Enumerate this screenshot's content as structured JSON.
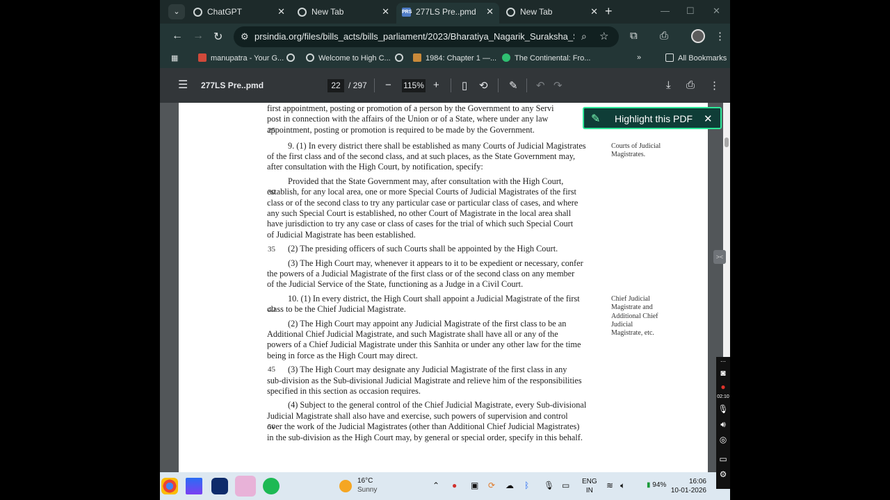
{
  "tabs": [
    {
      "title": "ChatGPT",
      "icon": "chatgpt-icon",
      "active": false
    },
    {
      "title": "New Tab",
      "icon": "chrome-icon",
      "active": false
    },
    {
      "title": "277LS Pre..pmd",
      "icon": "pdf-favicon",
      "active": true
    },
    {
      "title": "New Tab",
      "icon": "chrome-icon",
      "active": false
    }
  ],
  "address": {
    "url": "prsindia.org/files/bills_acts/bills_parliament/2023/Bharatiya_Nagarik_Suraksha_Sanhita,_..."
  },
  "bookmarks": [
    {
      "label": "manupatra - Your G...",
      "color": "#d0493a"
    },
    {
      "label": "Welcome to High C...",
      "color": "#cfd6d6"
    },
    {
      "label": "1984: Chapter 1 —...",
      "color": "#c98a3a"
    },
    {
      "label": "The Continental: Fro...",
      "color": "#2fbf71"
    }
  ],
  "all_bookmarks": "All Bookmarks",
  "pdf": {
    "title": "277LS Pre..pmd",
    "page": "22",
    "total": "/ 297",
    "zoom": "115%"
  },
  "document": {
    "lines": [
      "first appointment, posting or promotion of a person by the Government to any Servi",
      "post in connection with the affairs of the Union or of a State, where under any law",
      "appointment, posting or promotion is required to be made by the Government.",
      "9. (1) In every district there shall be established as many Courts of Judicial Magistrates",
      "of the first class and of the second class, and at such places, as the State Government may,",
      "after consultation with the High Court, by notification, specify:",
      "Provided that the State Government may, after consultation with the High Court,",
      "establish, for any local area, one or more Special Courts of Judicial Magistrates of the first",
      "class or of the second class to try any particular case or particular class of cases, and where",
      "any such Special Court is established, no other Court of Magistrate in the local area shall",
      "have jurisdiction to try any case or class of cases for the trial of which such Special Court",
      "of Judicial Magistrate has been established.",
      "(2) The presiding officers of such Courts shall be appointed by the High Court.",
      "(3) The High Court may, whenever it appears to it to be expedient or necessary, confer",
      "the powers of a Judicial Magistrate of the first class or of the second class on any member",
      "of the Judicial Service of the State, functioning as a Judge in a Civil Court.",
      "10. (1) In every district, the High Court shall appoint a Judicial Magistrate of the first",
      "class to be the Chief Judicial Magistrate.",
      "(2) The High Court may appoint any Judicial Magistrate of the first class to be an",
      "Additional Chief Judicial Magistrate, and such Magistrate shall have all or any of the",
      "powers of a Chief Judicial Magistrate under this Sanhita or under any other law for the time",
      "being in force as the High Court may direct.",
      "(3) The High Court may designate any Judicial Magistrate of the first class in any",
      "sub-division as the Sub-divisional Judicial Magistrate and relieve him of the responsibilities",
      "specified in this section as occasion requires.",
      "(4) Subject to the general control of the Chief Judicial Magistrate, every Sub-divisional",
      "Judicial Magistrate shall also have and exercise, such powers of supervision and control",
      "over the work of the Judicial Magistrates (other than Additional Chief Judicial Magistrates)",
      "in the sub-division as the High Court may, by general or special order, specify in this behalf."
    ],
    "line_numbers": [
      "25",
      "30",
      "35",
      "40",
      "45",
      "50"
    ],
    "margin_notes": [
      "Courts of Judicial Magistrates.",
      "Chief Judicial Magistrate and Additional Chief Judicial Magistrate, etc."
    ]
  },
  "highlight_popup": {
    "label": "Highlight this PDF"
  },
  "recorder": {
    "time": "02:10"
  },
  "taskbar": {
    "weather_temp": "16°C",
    "weather_cond": "Sunny",
    "lang_1": "ENG",
    "lang_2": "IN",
    "battery": "94%",
    "time": "16:06",
    "date": "10-01-2026"
  }
}
